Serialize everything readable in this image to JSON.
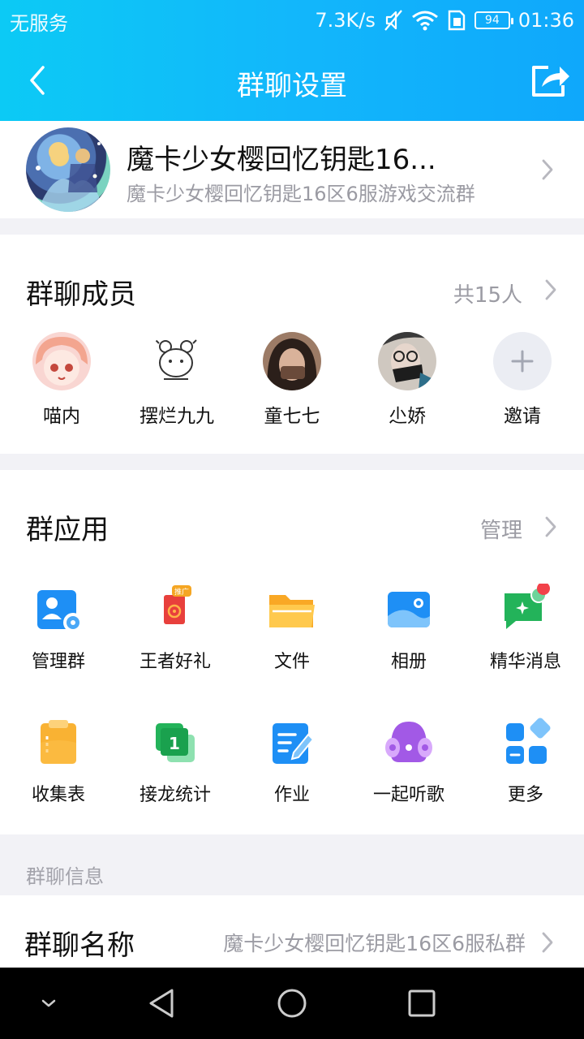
{
  "status": {
    "carrier": "无服务",
    "speed": "7.3K/s",
    "battery": "94",
    "time": "01:36"
  },
  "header": {
    "title": "群聊设置"
  },
  "group": {
    "name": "魔卡少女樱回忆钥匙16...",
    "description": "魔卡少女樱回忆钥匙16区6服游戏交流群"
  },
  "members": {
    "title": "群聊成员",
    "count": "共15人",
    "list": [
      {
        "name": "喵内"
      },
      {
        "name": "摆烂九九"
      },
      {
        "name": "童七七"
      },
      {
        "name": "尐娇"
      },
      {
        "name": "邀请"
      }
    ]
  },
  "apps": {
    "title": "群应用",
    "manage": "管理",
    "items": [
      {
        "label": "管理群",
        "icon": "manage-group-icon"
      },
      {
        "label": "王者好礼",
        "icon": "gift-icon"
      },
      {
        "label": "文件",
        "icon": "folder-icon"
      },
      {
        "label": "相册",
        "icon": "album-icon"
      },
      {
        "label": "精华消息",
        "icon": "essence-message-icon"
      },
      {
        "label": "收集表",
        "icon": "form-icon"
      },
      {
        "label": "接龙统计",
        "icon": "relay-icon"
      },
      {
        "label": "作业",
        "icon": "homework-icon"
      },
      {
        "label": "一起听歌",
        "icon": "music-icon"
      },
      {
        "label": "更多",
        "icon": "more-apps-icon"
      }
    ],
    "gift_badge": "推广"
  },
  "info": {
    "section_label": "群聊信息",
    "name_key": "群聊名称",
    "name_value": "魔卡少女樱回忆钥匙16区6服私群"
  },
  "colors": {
    "header_start": "#0ccaf5",
    "header_end": "#0fa8fb",
    "accent_blue": "#1e8ff5"
  }
}
